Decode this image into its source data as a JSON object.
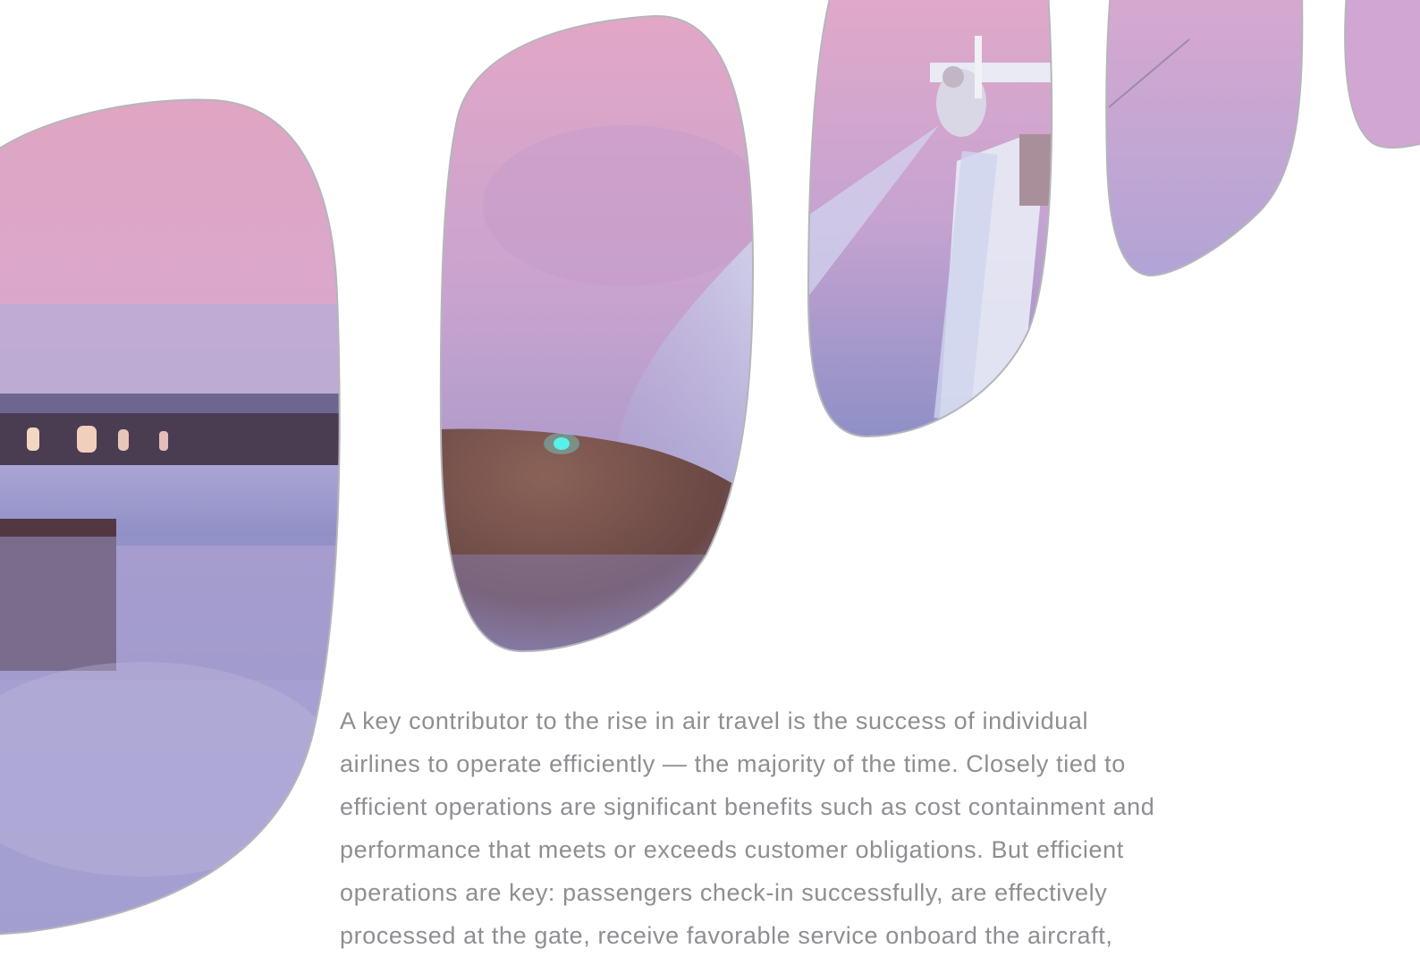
{
  "document": {
    "paragraph_lines": [
      "A key contributor to the rise in air travel is the success of individual",
      "airlines to operate efficiently — the majority of the time. Closely tied to",
      "efficient operations are significant benefits such as cost containment and",
      "performance that meets or exceeds customer obligations. But efficient",
      "operations are key: passengers check-in successfully, are effectively",
      "processed at the gate, receive favorable service onboard the aircraft,"
    ]
  },
  "colors": {
    "text": "#8e8e93",
    "window_border": "#b5b5bb",
    "sky_top": "#dfa6c4",
    "sky_mid": "#c7a2cf",
    "haze": "#9e9ccd",
    "deicing_fluid": "#b9bfe1",
    "wing_brown": "#6f4a45"
  }
}
